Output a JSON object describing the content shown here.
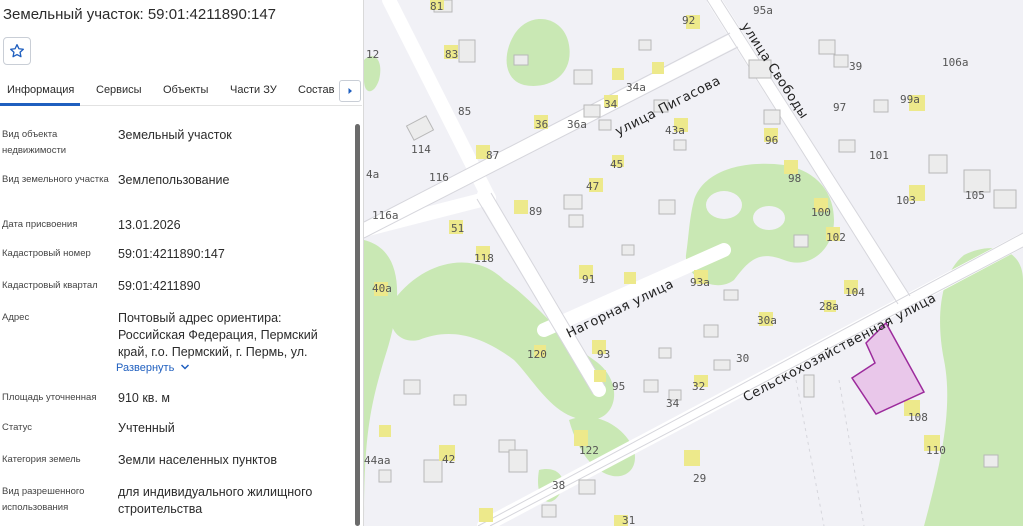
{
  "panel": {
    "title": "Земельный участок: 59:01:4211890:147",
    "tabs": [
      "Информация",
      "Сервисы",
      "Объекты",
      "Части ЗУ",
      "Состав"
    ],
    "rows": [
      {
        "label": "Вид объекта недвижимости",
        "value": "Земельный участок"
      },
      {
        "label": "Вид земельного участка",
        "value": "Землепользование"
      },
      {
        "label": "Дата присвоения",
        "value": "13.01.2026"
      },
      {
        "label": "Кадастровый номер",
        "value": "59:01:4211890:147"
      },
      {
        "label": "Кадастровый квартал",
        "value": "59:01:4211890"
      },
      {
        "label": "Адрес",
        "value": "Почтовый адрес ориентира: Российская Федерация, Пермский край, г.о. Пермский, г. Пермь, ул."
      },
      {
        "label": "Площадь уточненная",
        "value": "910 кв. м"
      },
      {
        "label": "Статус",
        "value": "Учтенный"
      },
      {
        "label": "Категория земель",
        "value": "Земли населенных пунктов"
      },
      {
        "label": "Вид разрешенного использования",
        "value": "для индивидуального жилищного строительства"
      }
    ],
    "expand_label": "Развернуть"
  },
  "map": {
    "streets": [
      "улица Пигасова",
      "улица Свободы",
      "Нагорная улица",
      "Сельскохозяйственная улица"
    ],
    "house_numbers": [
      "81",
      "92",
      "95а",
      "12",
      "83",
      "39",
      "106а",
      "34а",
      "85",
      "34",
      "97",
      "99а",
      "36",
      "36а",
      "43а",
      "96",
      "114",
      "87",
      "45",
      "101",
      "116",
      "47",
      "98",
      "4а",
      "89",
      "105",
      "116а",
      "51",
      "103",
      "100",
      "118",
      "102",
      "91",
      "93а",
      "40а",
      "104",
      "28а",
      "30а",
      "120",
      "93",
      "30",
      "95",
      "32",
      "34",
      "108",
      "44аа",
      "42",
      "122",
      "110",
      "38",
      "29",
      "31"
    ],
    "colors": {
      "background": "#f1f1f6",
      "park": "#c9e8b4",
      "building": "#ececec",
      "highlight_building": "#ede98b",
      "parcel_fill": "#e9c7ea",
      "parcel_stroke": "#9c2b9c"
    }
  }
}
